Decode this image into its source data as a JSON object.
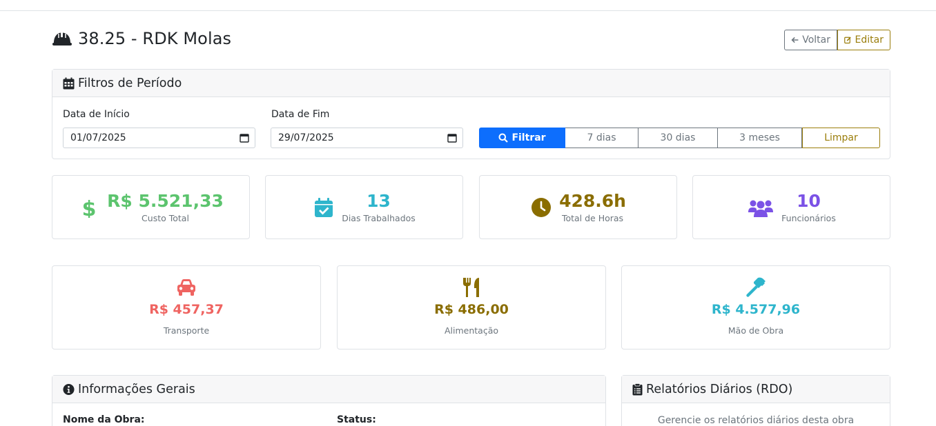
{
  "header": {
    "title": "38.25 - RDK Molas",
    "back_label": "Voltar",
    "edit_label": "Editar"
  },
  "filters": {
    "title": "Filtros de Período",
    "start_label": "Data de Início",
    "start_value": "01/07/2025",
    "end_label": "Data de Fim",
    "end_value": "29/07/2025",
    "filter_label": "Filtrar",
    "ranges": [
      "7 dias",
      "30 dias",
      "3 meses"
    ],
    "clear_label": "Limpar"
  },
  "stats": [
    {
      "value": "R$ 5.521,33",
      "label": "Custo Total",
      "color": "#5cc46e",
      "icon": "dollar-icon"
    },
    {
      "value": "13",
      "label": "Dias Trabalhados",
      "color": "#2eb5cc",
      "icon": "calendar-check-icon"
    },
    {
      "value": "428.6h",
      "label": "Total de Horas",
      "color": "#8a6d00",
      "icon": "clock-icon"
    },
    {
      "value": "10",
      "label": "Funcionários",
      "color": "#7b52e6",
      "icon": "users-icon"
    }
  ],
  "costs": [
    {
      "value": "R$ 457,37",
      "label": "Transporte",
      "color": "#ef6461",
      "icon": "car-icon"
    },
    {
      "value": "R$ 486,00",
      "label": "Alimentação",
      "color": "#8a6d00",
      "icon": "utensils-icon"
    },
    {
      "value": "R$ 4.577,96",
      "label": "Mão de Obra",
      "color": "#2eb5cc",
      "icon": "hammer-icon"
    }
  ],
  "info": {
    "title": "Informações Gerais",
    "name_label": "Nome da Obra:",
    "status_label": "Status:"
  },
  "rdo": {
    "title": "Relatórios Diários (RDO)",
    "description": "Gerencie os relatórios diários desta obra"
  },
  "colors": {
    "primary": "#0d6efd",
    "warning_outline": "#9a7d0a",
    "secondary": "#6c757d"
  }
}
